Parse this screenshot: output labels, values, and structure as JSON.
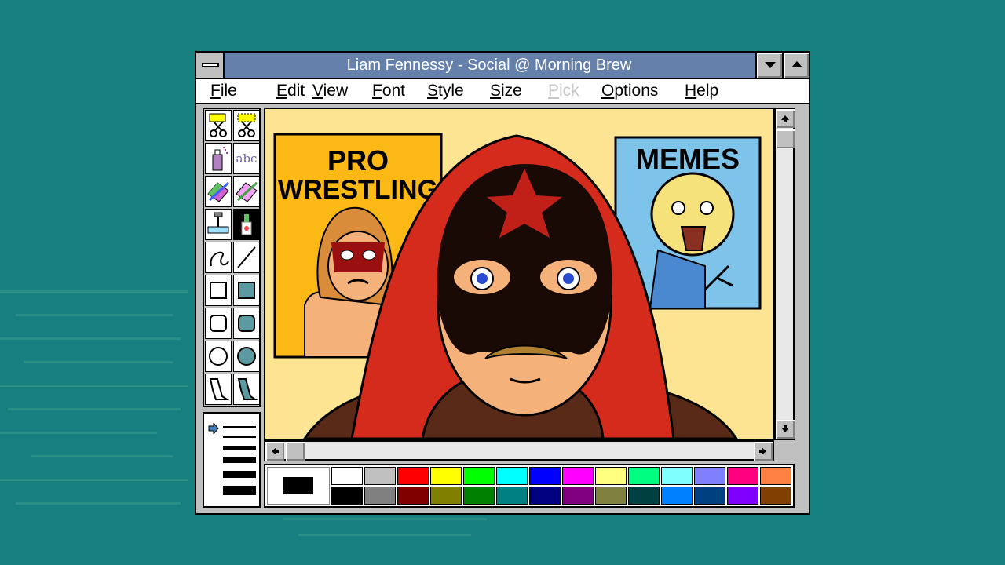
{
  "window": {
    "title": "Liam Fennessy - Social @ Morning Brew"
  },
  "menu": [
    {
      "label": "File",
      "enabled": true
    },
    {
      "label": "Edit",
      "enabled": true
    },
    {
      "label": "View",
      "enabled": true
    },
    {
      "label": "Font",
      "enabled": true
    },
    {
      "label": "Style",
      "enabled": true
    },
    {
      "label": "Size",
      "enabled": true
    },
    {
      "label": "Pick",
      "enabled": false
    },
    {
      "label": "Options",
      "enabled": true
    },
    {
      "label": "Help",
      "enabled": true
    }
  ],
  "tools": [
    "scissors-icon",
    "pick-scissors-icon",
    "airbrush-icon",
    "text-tool-icon",
    "color-eraser-icon",
    "eraser-icon",
    "paint-roller-icon",
    "brush-icon",
    "curve-icon",
    "line-icon",
    "box-icon",
    "filled-box-icon",
    "rounded-box-icon",
    "filled-rounded-box-icon",
    "circle-icon",
    "filled-circle-icon",
    "polygon-icon",
    "filled-polygon-icon"
  ],
  "text_tool_glyph": "abc",
  "canvas": {
    "poster_left": {
      "line1": "PRO",
      "line2": "WRESTLING"
    },
    "poster_right": {
      "title": "MEMES"
    }
  },
  "palette": {
    "foreground": "#000000",
    "top_row": [
      "#ffffff",
      "#c0c0c0",
      "#ff0000",
      "#ffff00",
      "#00ff00",
      "#00ffff",
      "#0000ff",
      "#ff00ff",
      "#ffff80",
      "#00ff80",
      "#80ffff",
      "#8080ff",
      "#ff0080",
      "#ff8040"
    ],
    "bottom_row": [
      "#000000",
      "#808080",
      "#800000",
      "#808000",
      "#008000",
      "#008080",
      "#000080",
      "#800080",
      "#808040",
      "#004040",
      "#0080ff",
      "#004080",
      "#8000ff",
      "#804000"
    ]
  }
}
